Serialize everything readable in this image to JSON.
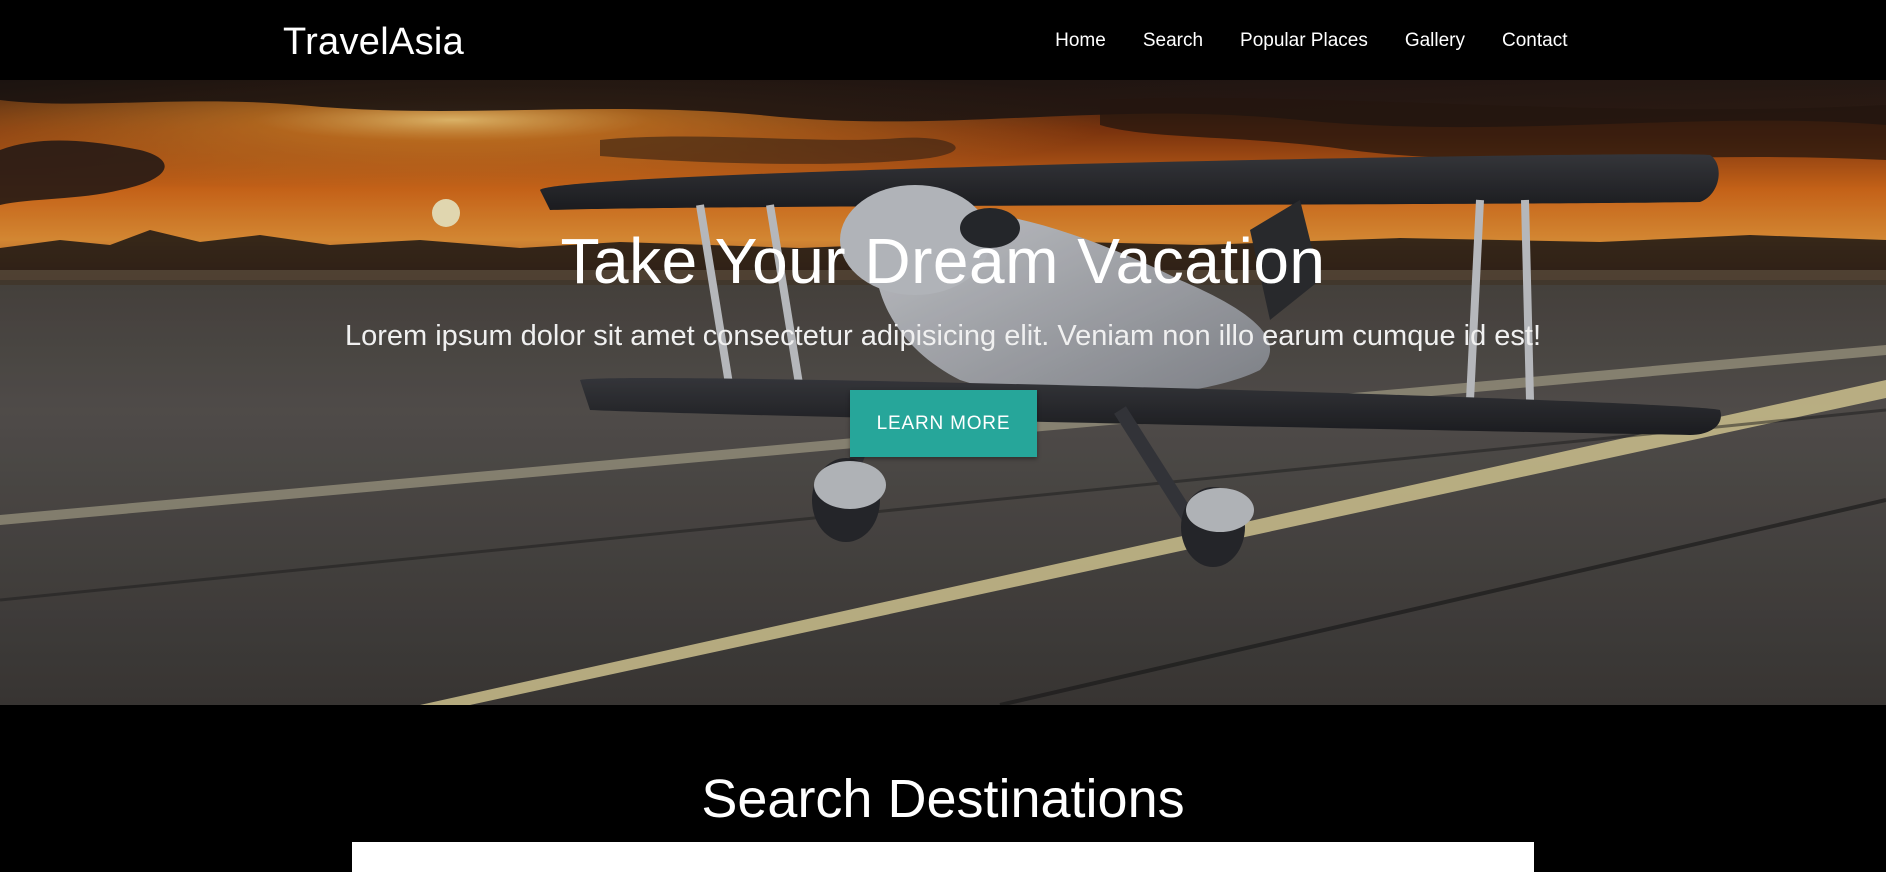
{
  "brand": "TravelAsia",
  "nav": {
    "items": [
      "Home",
      "Search",
      "Popular Places",
      "Gallery",
      "Contact"
    ]
  },
  "hero": {
    "title": "Take Your Dream Vacation",
    "subtitle": "Lorem ipsum dolor sit amet consectetur adipisicing elit. Veniam non illo earum cumque id est!",
    "button_label": "LEARN MORE"
  },
  "search_section": {
    "title": "Search Destinations"
  },
  "colors": {
    "accent": "#26a69a",
    "background": "#000000",
    "text": "#ffffff"
  }
}
